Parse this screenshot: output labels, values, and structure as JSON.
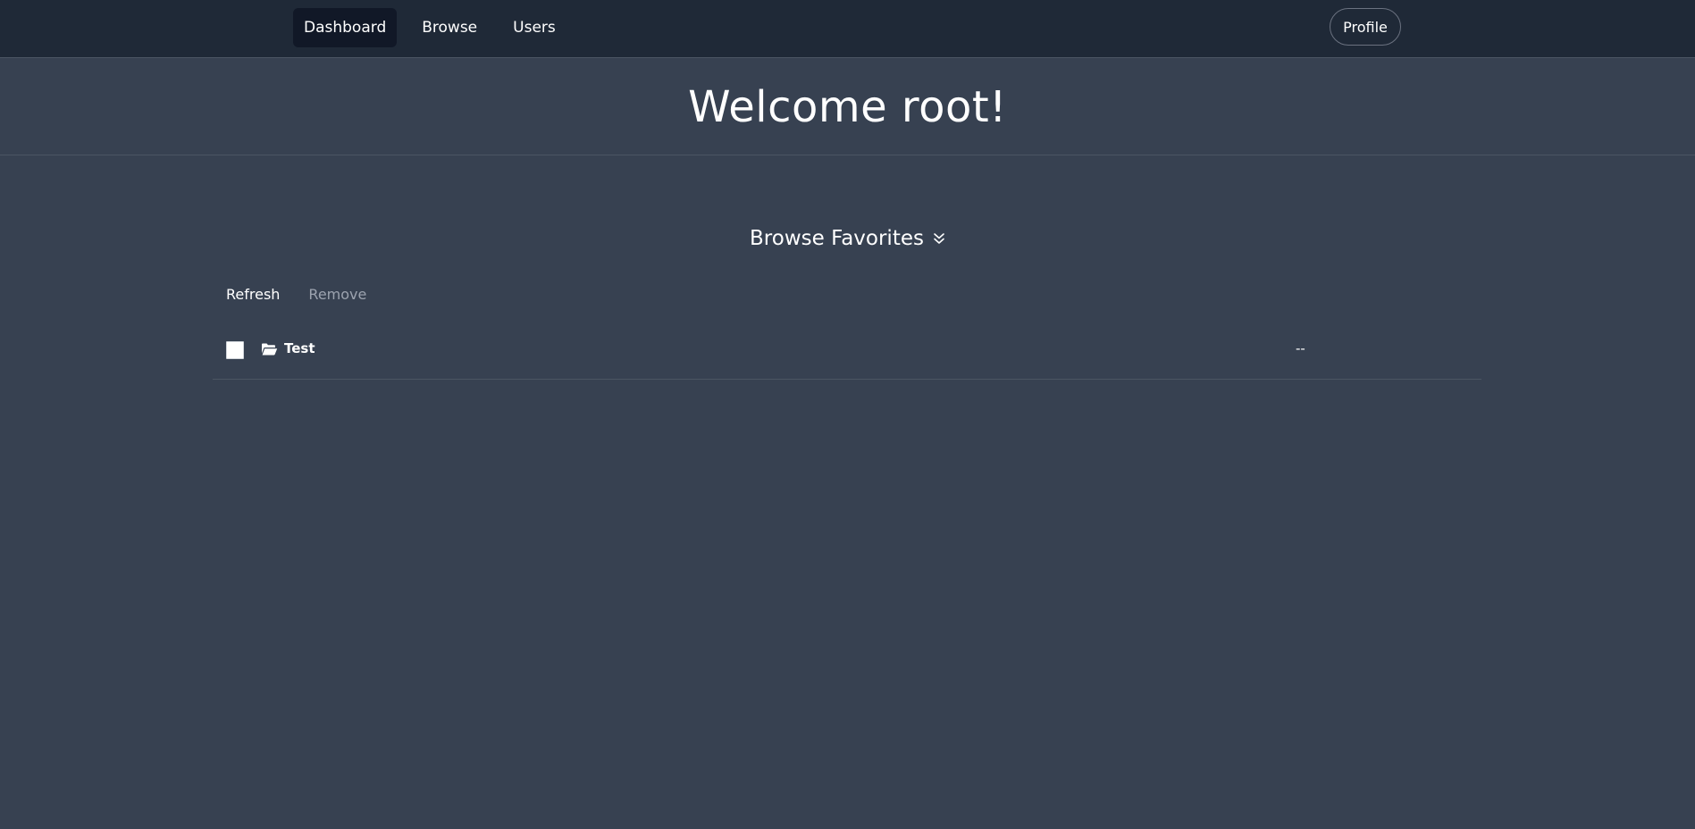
{
  "nav": {
    "links": [
      {
        "label": "Dashboard",
        "active": true
      },
      {
        "label": "Browse",
        "active": false
      },
      {
        "label": "Users",
        "active": false
      }
    ],
    "profile_label": "Profile"
  },
  "welcome": {
    "title": "Welcome root!"
  },
  "favorites": {
    "title": "Browse Favorites",
    "toggle_icon": "double-chevron-down-icon",
    "toolbar": {
      "refresh_label": "Refresh",
      "remove_label": "Remove"
    },
    "items": [
      {
        "name": "Test",
        "icon": "folder-open-icon",
        "checked": false,
        "size": "--"
      }
    ]
  },
  "colors": {
    "navbar_bg": "#1f2937",
    "page_bg": "#374151",
    "active_nav_bg": "#111827",
    "divider": "#4b5563",
    "disabled_text": "#9ca3af"
  }
}
